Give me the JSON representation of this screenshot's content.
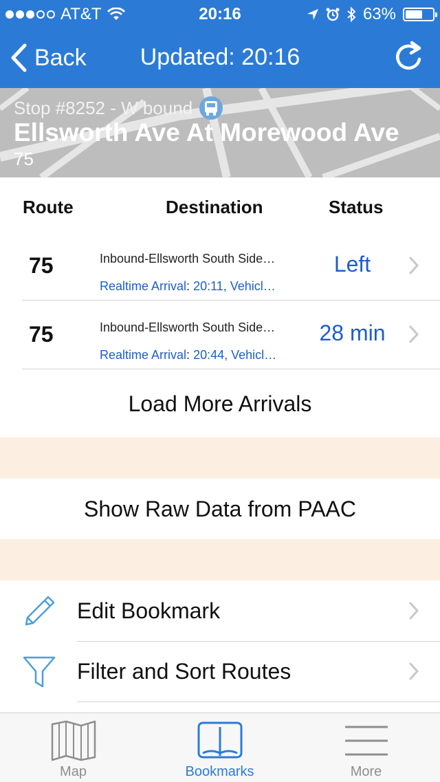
{
  "status_bar": {
    "carrier": "AT&T",
    "time": "20:16",
    "battery": "63%",
    "battery_level": 0.63
  },
  "nav": {
    "back_label": "Back",
    "title": "Updated: 20:16"
  },
  "stop": {
    "number": "Stop #8252 - W bound",
    "name": "Ellsworth Ave At Morewood Ave",
    "route": "75"
  },
  "columns": {
    "route": "Route",
    "destination": "Destination",
    "status": "Status"
  },
  "arrivals": [
    {
      "route": "75",
      "destination": "Inbound-Ellsworth South Side…",
      "realtime_label": "Realtime Arrival",
      "realtime_value": " 20:11, Vehicl…",
      "status": "Left"
    },
    {
      "route": "75",
      "destination": "Inbound-Ellsworth South Side…",
      "realtime_label": "Realtime Arrival",
      "realtime_value": " 20:44, Vehicl…",
      "status": "28 min"
    }
  ],
  "actions": {
    "load_more": "Load More Arrivals",
    "raw_data": "Show Raw Data from PAAC"
  },
  "menu": [
    {
      "label": "Edit Bookmark",
      "icon": "pencil-icon"
    },
    {
      "label": "Filter and Sort Routes",
      "icon": "filter-icon"
    }
  ],
  "tabs": [
    {
      "label": "Map",
      "icon": "map-icon",
      "active": false
    },
    {
      "label": "Bookmarks",
      "icon": "book-icon",
      "active": true
    },
    {
      "label": "More",
      "icon": "menu-lines-icon",
      "active": false
    }
  ],
  "colors": {
    "brand_blue": "#2b7bd6",
    "link_blue": "#1e5dc9",
    "spacer_peach": "#fcefe2"
  }
}
